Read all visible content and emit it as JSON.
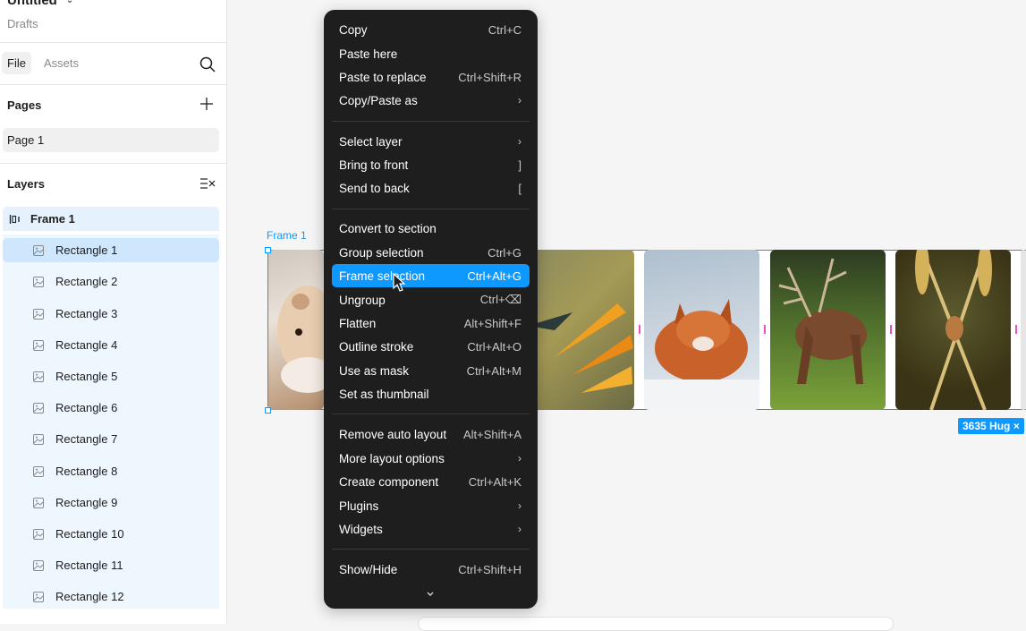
{
  "file": {
    "title": "Untitled",
    "location": "Drafts"
  },
  "tabs": {
    "file": "File",
    "assets": "Assets"
  },
  "pages": {
    "title": "Pages",
    "items": [
      "Page 1"
    ]
  },
  "layers": {
    "title": "Layers",
    "frame": "Frame 1",
    "items": [
      "Rectangle 1",
      "Rectangle 2",
      "Rectangle 3",
      "Rectangle 4",
      "Rectangle 5",
      "Rectangle 6",
      "Rectangle 7",
      "Rectangle 8",
      "Rectangle 9",
      "Rectangle 10",
      "Rectangle 11",
      "Rectangle 12"
    ]
  },
  "canvas": {
    "frame_label": "Frame 1",
    "hug_badge": "3635 Hug ×"
  },
  "menu": {
    "copy": {
      "label": "Copy",
      "shortcut": "Ctrl+C"
    },
    "paste_here": {
      "label": "Paste here",
      "shortcut": ""
    },
    "paste_replace": {
      "label": "Paste to replace",
      "shortcut": "Ctrl+Shift+R"
    },
    "copy_paste_as": {
      "label": "Copy/Paste as",
      "shortcut": "›"
    },
    "select_layer": {
      "label": "Select layer",
      "shortcut": "›"
    },
    "bring_front": {
      "label": "Bring to front",
      "shortcut": "]"
    },
    "send_back": {
      "label": "Send to back",
      "shortcut": "["
    },
    "convert_section": {
      "label": "Convert to section",
      "shortcut": ""
    },
    "group_selection": {
      "label": "Group selection",
      "shortcut": "Ctrl+G"
    },
    "frame_selection": {
      "label": "Frame selection",
      "shortcut": "Ctrl+Alt+G"
    },
    "ungroup": {
      "label": "Ungroup",
      "shortcut": "Ctrl+⌫"
    },
    "flatten": {
      "label": "Flatten",
      "shortcut": "Alt+Shift+F"
    },
    "outline_stroke": {
      "label": "Outline stroke",
      "shortcut": "Ctrl+Alt+O"
    },
    "use_mask": {
      "label": "Use as mask",
      "shortcut": "Ctrl+Alt+M"
    },
    "set_thumbnail": {
      "label": "Set as thumbnail",
      "shortcut": ""
    },
    "remove_auto_layout": {
      "label": "Remove auto layout",
      "shortcut": "Alt+Shift+A"
    },
    "more_layout": {
      "label": "More layout options",
      "shortcut": "›"
    },
    "create_component": {
      "label": "Create component",
      "shortcut": "Ctrl+Alt+K"
    },
    "plugins": {
      "label": "Plugins",
      "shortcut": "›"
    },
    "widgets": {
      "label": "Widgets",
      "shortcut": "›"
    },
    "show_hide": {
      "label": "Show/Hide",
      "shortcut": "Ctrl+Shift+H"
    }
  },
  "colors": {
    "accent": "#0d99ff",
    "menu_bg": "#1e1e1e",
    "gap_marker": "#f24ec4"
  },
  "icons": [
    "chevron-down-icon",
    "search-icon",
    "plus-icon",
    "layers-toggle-icon",
    "frame-autolayout-icon",
    "image-icon",
    "submenu-arrow-icon",
    "cursor-icon"
  ]
}
